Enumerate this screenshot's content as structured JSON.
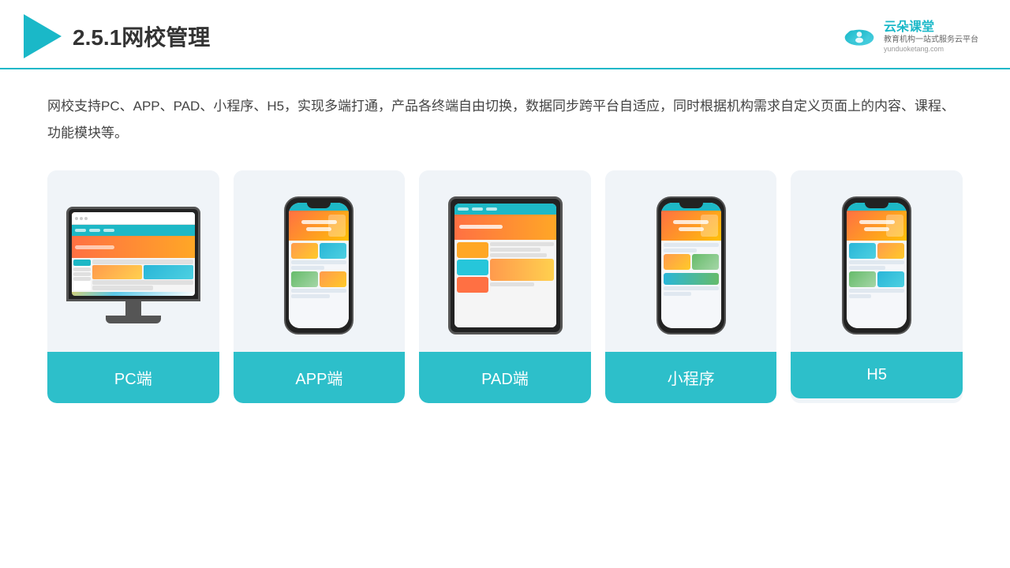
{
  "header": {
    "title": "2.5.1网校管理",
    "brand": {
      "name": "云朵课堂",
      "tagline": "教育机构一站\n式服务云平台",
      "url": "yunduoketang.com"
    }
  },
  "description": "网校支持PC、APP、PAD、小程序、H5，实现多端打通，产品各终端自由切换，数据同步跨平台自适应，同时根据机构需求自定义页面上的内容、课程、功能模块等。",
  "cards": [
    {
      "id": "pc",
      "label": "PC端"
    },
    {
      "id": "app",
      "label": "APP端"
    },
    {
      "id": "pad",
      "label": "PAD端"
    },
    {
      "id": "miniprogram",
      "label": "小程序"
    },
    {
      "id": "h5",
      "label": "H5"
    }
  ]
}
